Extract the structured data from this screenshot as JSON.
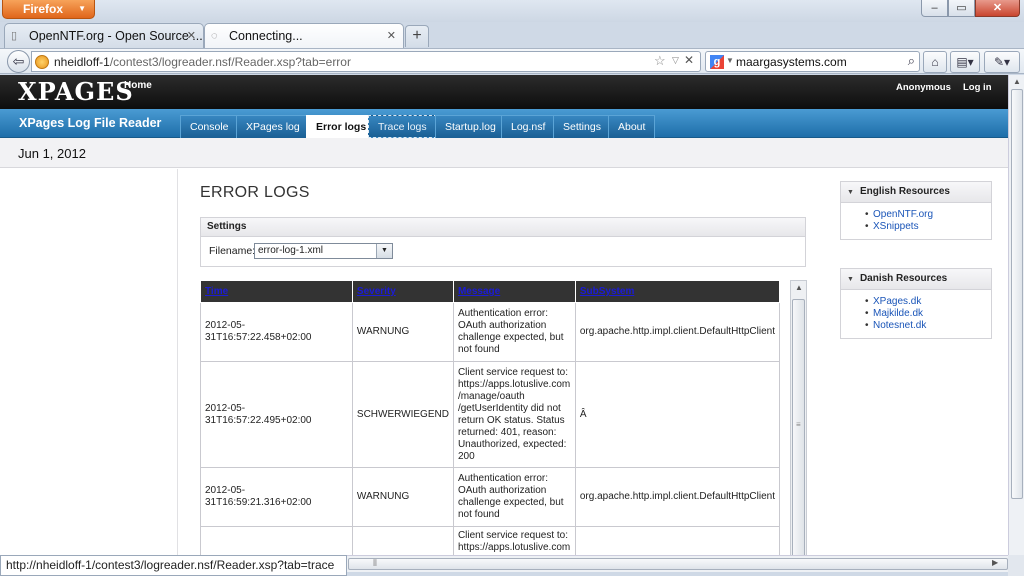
{
  "browser": {
    "app_button": "Firefox",
    "tabs": [
      {
        "title": "OpenNTF.org - Open Source ..."
      },
      {
        "title": "Connecting..."
      }
    ],
    "url_host": "nheidloff-1",
    "url_path": "/contest3/logreader.nsf/Reader.xsp?tab=error",
    "search_value": "maargasystems.com",
    "status_text": "http://nheidloff-1/contest3/logreader.nsf/Reader.xsp?tab=trace"
  },
  "header": {
    "logo": "XPAGES",
    "home": "Home",
    "anonymous": "Anonymous",
    "login": "Log in"
  },
  "nav": {
    "app_title": "XPages Log File Reader",
    "tabs": [
      "Console",
      "XPages log",
      "Error logs",
      "Trace logs",
      "Startup.log",
      "Log.nsf",
      "Settings",
      "About"
    ],
    "active_tab": "Error logs",
    "hovered_tab": "Trace logs"
  },
  "date": "Jun 1, 2012",
  "main": {
    "title": "ERROR LOGS",
    "settings_title": "Settings",
    "filename_label": "Filename:",
    "filename_value": "error-log-1.xml",
    "columns": [
      "Time",
      "Severity",
      "Message",
      "SubSystem"
    ],
    "rows": [
      {
        "time": "2012-05-31T16:57:22.458+02:00",
        "severity": "WARNUNG",
        "message": "Authentication error: OAuth authorization challenge expected, but not found",
        "subsystem": "org.apache.http.impl.client.DefaultHttpClient"
      },
      {
        "time": "2012-05-31T16:57:22.495+02:00",
        "severity": "SCHWERWIEGEND",
        "message": "Client service request to: https://apps.lotuslive.com /manage/oauth /getUserIdentity did not return OK status. Status returned: 401, reason: Unauthorized, expected: 200",
        "subsystem": "Â"
      },
      {
        "time": "2012-05-31T16:59:21.316+02:00",
        "severity": "WARNUNG",
        "message": "Authentication error: OAuth authorization challenge expected, but not found",
        "subsystem": "org.apache.http.impl.client.DefaultHttpClient"
      },
      {
        "time": "",
        "severity": "",
        "message": "Client service request to: https://apps.lotuslive.com",
        "subsystem": ""
      }
    ]
  },
  "sidebar": {
    "english": {
      "title": "English Resources",
      "links": [
        "OpenNTF.org",
        "XSnippets"
      ]
    },
    "danish": {
      "title": "Danish Resources",
      "links": [
        "XPages.dk",
        "Majkilde.dk",
        "Notesnet.dk"
      ]
    }
  }
}
